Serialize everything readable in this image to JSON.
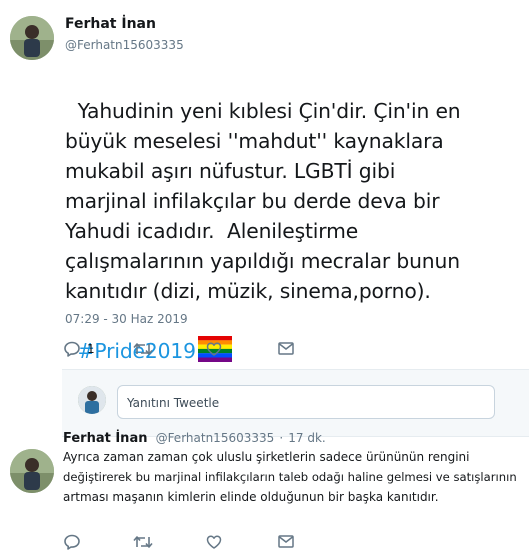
{
  "main_tweet": {
    "author_name": "Ferhat İnan",
    "author_handle": "@Ferhatn15603335",
    "text": "Yahudinin yeni kıblesi Çin'dir. Çin'in en\nbüyük meselesi ''mahdut'' kaynaklara\nmukabil aşırı nüfustur. LGBTİ gibi\nmarjinal infilakçılar bu derde deva bir\nYahudi icadıdır.  Alenileştirme\nçalışmalarının yapıldığı mecralar bunun\nkanıtıdır (dizi, müzik, sinema,porno).",
    "hashtag": "#Pride2019",
    "timestamp": "07:29 - 30 Haz 2019",
    "reply_count": "1",
    "icons": [
      "reply-icon",
      "retweet-icon",
      "like-icon",
      "message-icon"
    ]
  },
  "compose": {
    "placeholder": "Yanıtını Tweetle"
  },
  "reply_tweet": {
    "author_name": "Ferhat İnan",
    "author_handle": "@Ferhatn15603335",
    "separator": "·",
    "time_ago": "17 dk.",
    "text_lines": [
      "Ayrıca zaman zaman çok uluslu şirketlerin sadece ürününün rengini",
      "değiştirerek bu marjinal infilakçıların taleb odağı haline gelmesi ve satışlarının",
      "artması maşanın kimlerin elinde olduğunun bir başka kanıtıdır."
    ]
  },
  "colors": {
    "link": "#1b95e0",
    "muted": "#657786",
    "border": "#e6ecf0",
    "pride_flag": [
      "#e40303",
      "#ff8c00",
      "#ffed00",
      "#008026",
      "#004dff",
      "#750787"
    ]
  }
}
